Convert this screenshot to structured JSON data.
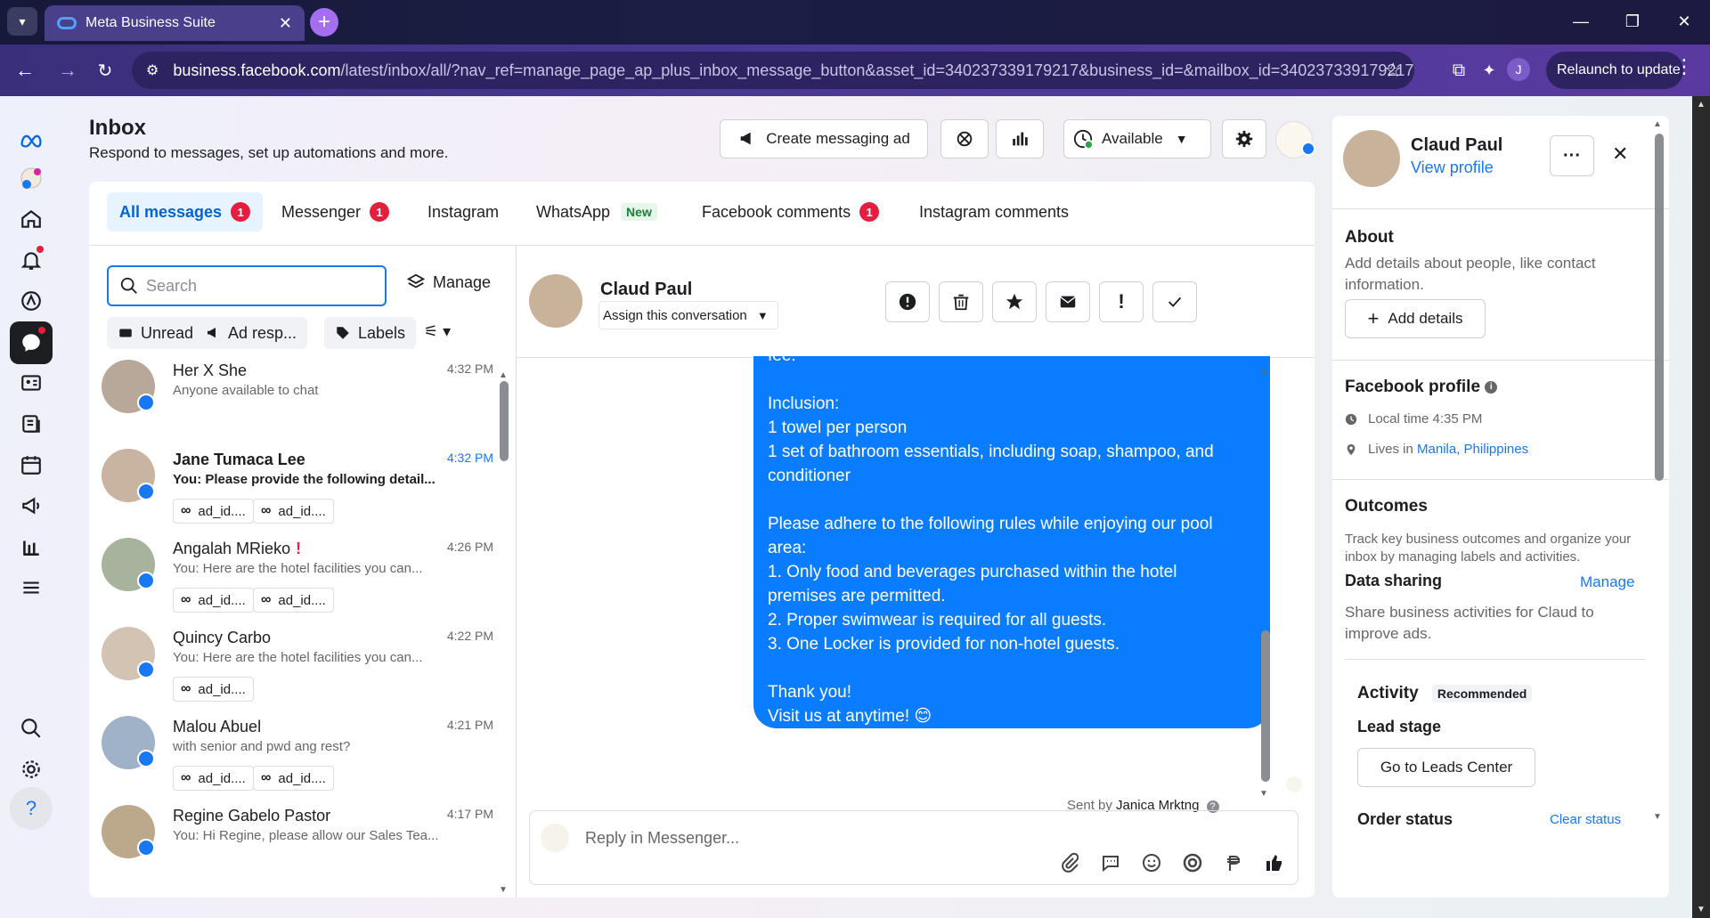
{
  "browser": {
    "tab_title": "Meta Business Suite",
    "url_host": "business.facebook.com",
    "url_path": "/latest/inbox/all/?nav_ref=manage_page_ap_plus_inbox_message_button&asset_id=340237339179217&business_id=&mailbox_id=340237339179217...",
    "profile_initial": "J",
    "relaunch_label": "Relaunch to update"
  },
  "header": {
    "title": "Inbox",
    "subtitle": "Respond to messages, set up automations and more.",
    "create_ad_label": "Create messaging ad",
    "status_label": "Available"
  },
  "tabs": [
    {
      "label": "All messages",
      "badge": "1"
    },
    {
      "label": "Messenger",
      "badge": "1"
    },
    {
      "label": "Instagram"
    },
    {
      "label": "WhatsApp",
      "tag": "New"
    },
    {
      "label": "Facebook comments",
      "badge": "1"
    },
    {
      "label": "Instagram comments"
    }
  ],
  "list": {
    "search_placeholder": "Search",
    "manage_label": "Manage",
    "chips": [
      "Unread",
      "Ad resp...",
      "Labels"
    ],
    "conversations": [
      {
        "name": "Her X She",
        "snippet": "Anyone available to chat",
        "time": "4:32 PM",
        "ads": []
      },
      {
        "name": "Jane Tumaca Lee",
        "snippet": "You: Please provide the following detail...",
        "time": "4:32 PM",
        "ads": [
          "ad_id....",
          "ad_id...."
        ]
      },
      {
        "name": "Angalah MRieko",
        "flag": "!",
        "snippet": "You: Here are the hotel facilities you can...",
        "time": "4:26 PM",
        "ads": [
          "ad_id....",
          "ad_id...."
        ]
      },
      {
        "name": "Quincy Carbo",
        "snippet": "You: Here are the hotel facilities you can...",
        "time": "4:22 PM",
        "ads": [
          "ad_id...."
        ]
      },
      {
        "name": "Malou Abuel",
        "snippet": "with senior and pwd ang rest?",
        "time": "4:21 PM",
        "ads": [
          "ad_id....",
          "ad_id...."
        ]
      },
      {
        "name": "Regine Gabelo Pastor",
        "snippet": "You: Hi Regine, please allow our Sales Tea...",
        "time": "4:17 PM",
        "ads": []
      }
    ]
  },
  "chat": {
    "name": "Claud Paul",
    "assign_label": "Assign this conversation",
    "message_lines": [
      "fee.",
      "",
      "Inclusion:",
      "1 towel per person",
      "1 set of bathroom essentials, including soap, shampoo, and",
      "conditioner",
      "",
      "Please adhere to the following rules while enjoying our pool",
      "area:",
      "1. Only food and beverages purchased within the hotel",
      "premises are permitted.",
      "2. Proper swimwear is required for all guests.",
      "3. One Locker is provided for non-hotel guests.",
      "",
      "Thank you!",
      "Visit us at anytime! 😊"
    ],
    "sent_by_prefix": "Sent by",
    "sent_by_name": "Janica Mrktng",
    "reply_placeholder": "Reply in Messenger..."
  },
  "side": {
    "name": "Claud Paul",
    "view_profile": "View profile",
    "about_title": "About",
    "about_text": "Add details about people, like contact information.",
    "add_details": "Add details",
    "fb_profile_title": "Facebook profile",
    "local_time": "Local time 4:35 PM",
    "lives_in_prefix": "Lives in",
    "lives_in_place": "Manila, Philippines",
    "outcomes_title": "Outcomes",
    "outcomes_text": "Track key business outcomes and organize your inbox by managing labels and activities.",
    "data_sharing_title": "Data sharing",
    "data_sharing_manage": "Manage",
    "data_sharing_text": "Share business activities for Claud to improve ads.",
    "activity_title": "Activity",
    "activity_tag": "Recommended",
    "lead_stage_title": "Lead stage",
    "leads_center_btn": "Go to Leads Center",
    "order_status_title": "Order status",
    "clear_status": "Clear status"
  },
  "colors": {
    "accent": "#1877f2",
    "bubble": "#0a7cff",
    "badge": "#e41e3f"
  }
}
